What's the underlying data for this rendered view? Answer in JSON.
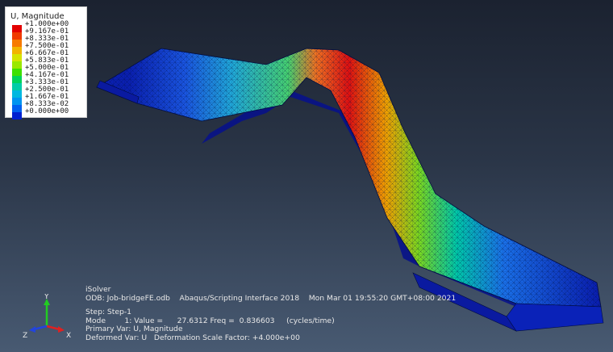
{
  "legend": {
    "title": "U, Magnitude",
    "colors": [
      "#e30000",
      "#f03a00",
      "#f77a00",
      "#f2b400",
      "#d6e400",
      "#9ae800",
      "#3ee000",
      "#00d45a",
      "#00cca8",
      "#00b8e0",
      "#0094f0",
      "#0060f0",
      "#0020d0"
    ],
    "values": [
      "+1.000e+00",
      "+9.167e-01",
      "+8.333e-01",
      "+7.500e-01",
      "+6.667e-01",
      "+5.833e-01",
      "+5.000e-01",
      "+4.167e-01",
      "+3.333e-01",
      "+2.500e-01",
      "+1.667e-01",
      "+8.333e-02",
      "+0.000e+00"
    ]
  },
  "triad": {
    "y": "Y",
    "x": "X",
    "z": "Z"
  },
  "info": {
    "solver": "iSolver",
    "odb": "ODB: Job-bridgeFE.odb    Abaqus/Scripting Interface 2018    Mon Mar 01 19:55:20 GMT+08:00 2021",
    "step": "Step: Step-1",
    "mode": "Mode        1: Value =      27.6312 Freq =  0.836603     (cycles/time)",
    "primary_var": "Primary Var: U, Magnitude",
    "deformed_var": "Deformed Var: U   Deformation Scale Factor: +4.000e+00"
  }
}
